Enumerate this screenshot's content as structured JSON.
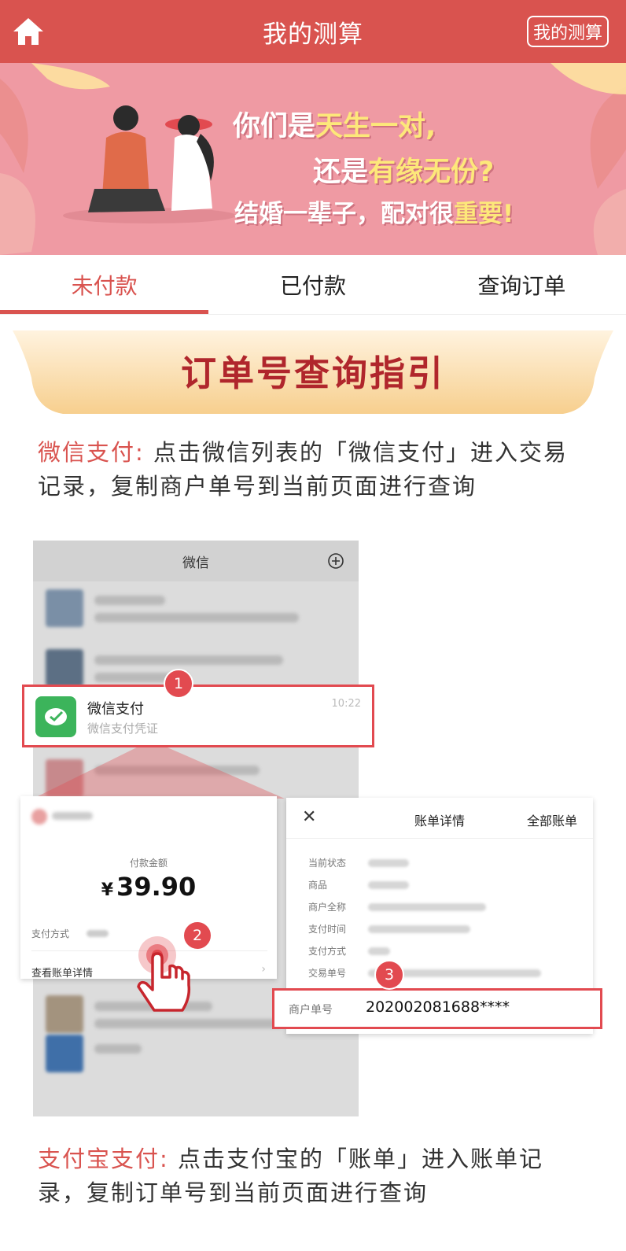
{
  "header": {
    "title": "我的测算",
    "right_button": "我的测算",
    "home_icon": "home-icon"
  },
  "banner": {
    "line1_a": "你们是",
    "line1_b": "天生一对,",
    "line2_a": "还是",
    "line2_b": "有缘无份?",
    "line3_a": "结婚一辈子，配对很",
    "line3_b": "重要!"
  },
  "tabs": [
    {
      "label": "未付款",
      "active": true
    },
    {
      "label": "已付款",
      "active": false
    },
    {
      "label": "查询订单",
      "active": false
    }
  ],
  "guide": {
    "title": "订单号查询指引",
    "wechat_label": "微信支付:",
    "wechat_text": "点击微信列表的「微信支付」进入交易记录，复制商户单号到当前页面进行查询",
    "alipay_label": "支付宝支付:",
    "alipay_text": "点击支付宝的「账单」进入账单记录，复制订单号到当前页面进行查询"
  },
  "phone": {
    "title": "微信",
    "wx_name": "微信支付",
    "wx_sub": "微信支付凭证",
    "wx_time": "10:22",
    "badges": [
      "1",
      "2",
      "3"
    ],
    "pay_amount_label": "付款金额",
    "currency": "¥",
    "pay_amount": "39.90",
    "pay_method_label": "支付方式",
    "view_detail": "查看账单详情",
    "bill_title": "账单详情",
    "bill_all": "全部账单",
    "bill_rows": [
      "当前状态",
      "商品",
      "商户全称",
      "支付时间",
      "支付方式",
      "交易单号"
    ],
    "merchant_label": "商户单号",
    "merchant_no": "202002081688****"
  },
  "colors": {
    "brand": "#d9534f",
    "highlight": "#fde87a",
    "wechat_green": "#3cb45b"
  }
}
